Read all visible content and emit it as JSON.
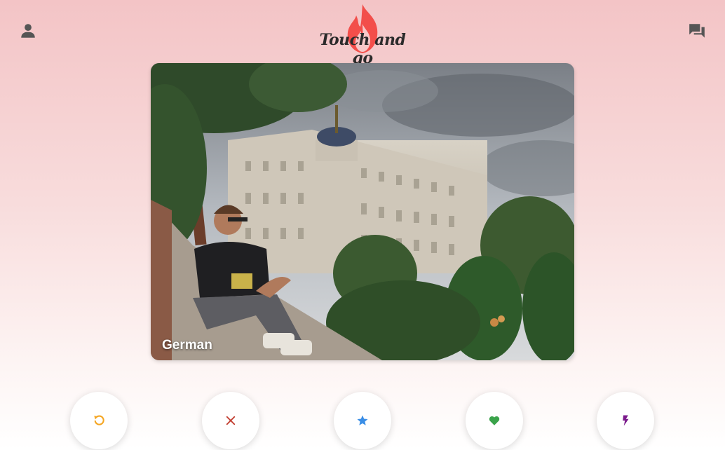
{
  "app": {
    "logo_text": "Touch and go",
    "logo_color": "#f2433f"
  },
  "header": {
    "profile_icon": "person-icon",
    "messages_icon": "forum-icon",
    "icon_color": "#555555"
  },
  "card": {
    "name": "German",
    "photo_description_icon": "profile-photo"
  },
  "actions": [
    {
      "name": "rewind",
      "icon": "undo-icon",
      "color": "#f5a623"
    },
    {
      "name": "nope",
      "icon": "close-icon",
      "color": "#c0392b"
    },
    {
      "name": "super-like",
      "icon": "star-icon",
      "color": "#3a8ee6"
    },
    {
      "name": "like",
      "icon": "heart-icon",
      "color": "#3aa34a"
    },
    {
      "name": "boost",
      "icon": "bolt-icon",
      "color": "#7b1a8c"
    }
  ]
}
